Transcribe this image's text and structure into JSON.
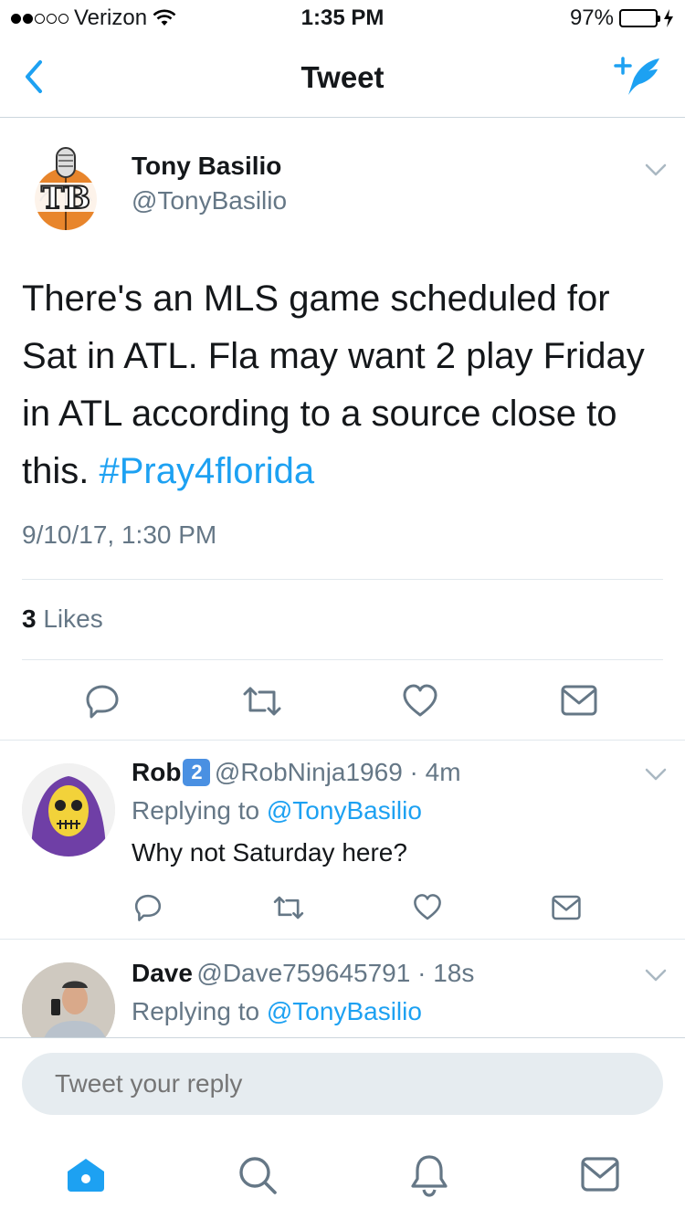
{
  "status": {
    "carrier": "Verizon",
    "time": "1:35 PM",
    "battery": "97%",
    "battery_level": 0.97
  },
  "nav": {
    "title": "Tweet"
  },
  "tweet": {
    "author_name": "Tony Basilio",
    "author_handle": "@TonyBasilio",
    "text": "There's an MLS game scheduled for Sat in ATL. Fla may want 2 play Friday in ATL according to a source close to this. ",
    "hashtag": "#Pray4florida",
    "timestamp": "9/10/17, 1:30 PM",
    "likes_count": "3",
    "likes_label": " Likes"
  },
  "replies": [
    {
      "name": "Rob",
      "badge": "2",
      "handle": "@RobNinja1969",
      "age": " · 4m",
      "replying_prefix": "Replying to ",
      "replying_to": "@TonyBasilio",
      "text": "Why not Saturday here?"
    },
    {
      "name": "Dave",
      "handle": "@Dave759645791",
      "age": " · 18s",
      "replying_prefix": "Replying to ",
      "replying_to": "@TonyBasilio"
    }
  ],
  "reply_box": {
    "placeholder": "Tweet your reply"
  },
  "colors": {
    "accent": "#1da1f2",
    "secondary_text": "#657786",
    "divider": "#e1e8ed"
  },
  "tabbar": {
    "icons": [
      "home-icon",
      "search-icon",
      "notifications-icon",
      "messages-icon"
    ]
  }
}
